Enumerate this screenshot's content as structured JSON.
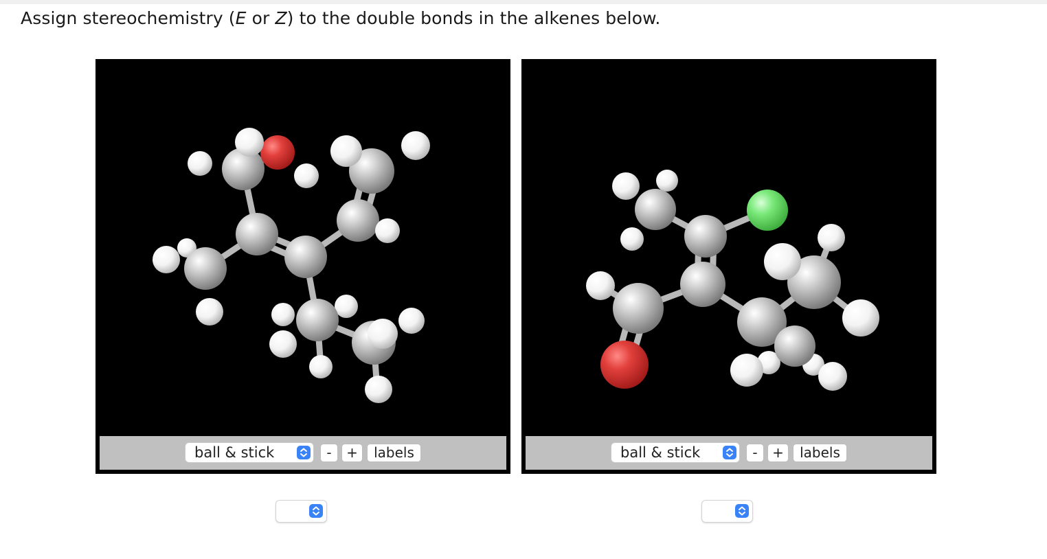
{
  "question": {
    "prefix": "Assign stereochemistry (",
    "e": "E",
    "or": " or ",
    "z": "Z",
    "suffix": ") to the double bonds in the alkenes below."
  },
  "viewers": [
    {
      "style_value": "ball & stick",
      "minus_label": "-",
      "plus_label": "+",
      "labels_label": "labels",
      "answer_value": ""
    },
    {
      "style_value": "ball & stick",
      "minus_label": "-",
      "plus_label": "+",
      "labels_label": "labels",
      "answer_value": ""
    }
  ],
  "icons": {
    "select_arrow": "updown-chevron-icon"
  },
  "colors": {
    "carbon": "#a9a9a9",
    "hydrogen": "#f2f2f2",
    "oxygen": "#e0302e",
    "chlorine": "#6ee36e",
    "select_accent": "#3a82f7",
    "control_bar": "#c0c0c0"
  }
}
